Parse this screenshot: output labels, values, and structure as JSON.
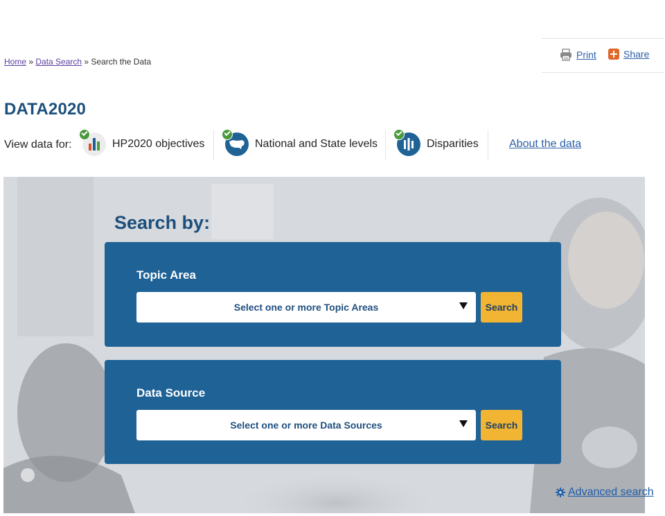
{
  "utility": {
    "print_label": "Print",
    "share_label": "Share"
  },
  "breadcrumb": {
    "home": "Home",
    "sep1": " » ",
    "data_search": "Data Search",
    "sep2": " » ",
    "current": "Search the Data"
  },
  "page": {
    "title": "DATA2020"
  },
  "view_data": {
    "label": "View data for:",
    "items": [
      {
        "label": "HP2020 objectives",
        "icon": "bar-chart-icon"
      },
      {
        "label": "National and State levels",
        "icon": "us-map-icon"
      },
      {
        "label": "Disparities",
        "icon": "disparities-icon"
      }
    ],
    "about_label": "About the data"
  },
  "hero": {
    "heading": "Search by:",
    "topic": {
      "label": "Topic Area",
      "placeholder": "Select one or more Topic Areas",
      "button": "Search"
    },
    "source": {
      "label": "Data Source",
      "placeholder": "Select one or more Data Sources",
      "button": "Search"
    },
    "advanced_label": "Advanced search"
  },
  "colors": {
    "brand_blue": "#1f6296",
    "title_blue": "#1d4f7c",
    "button_yellow": "#f2b533",
    "check_green": "#4a9a3e",
    "link_blue": "#2a5fa8"
  }
}
